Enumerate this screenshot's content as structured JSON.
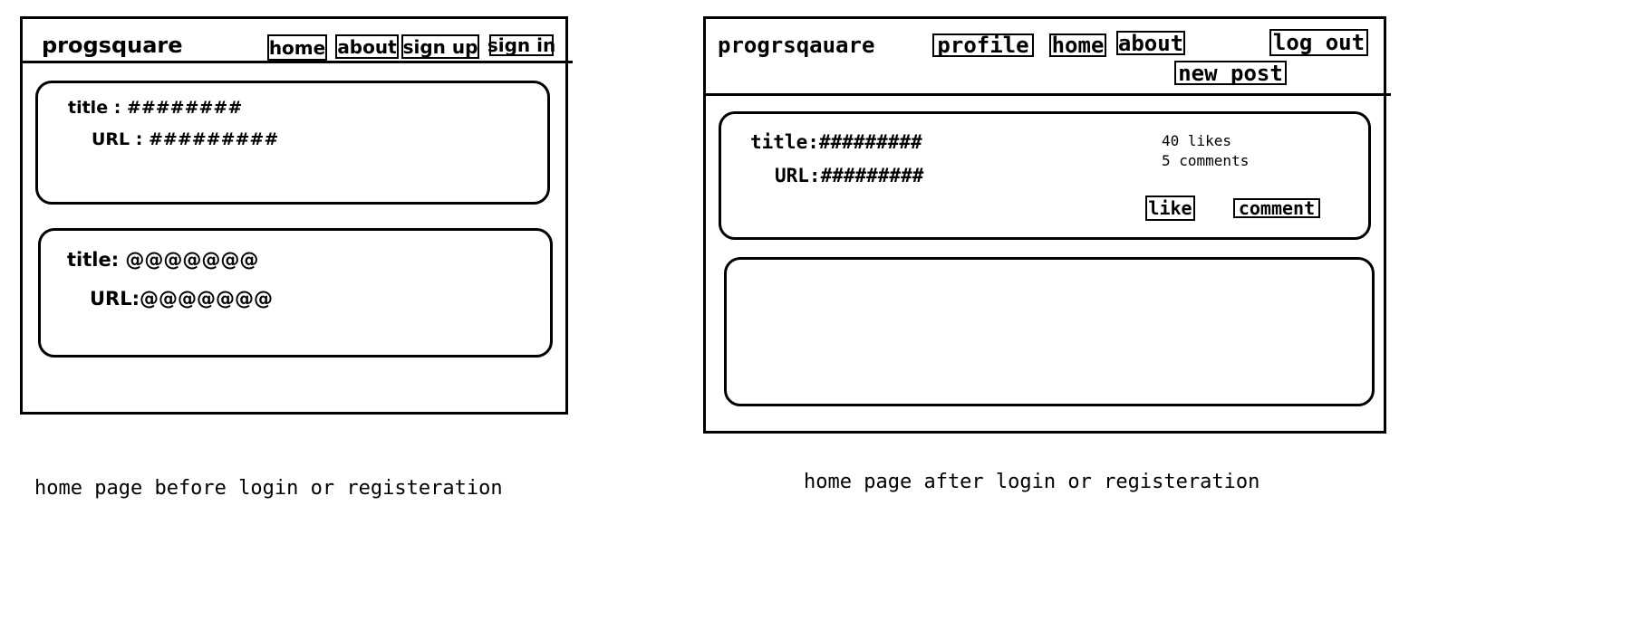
{
  "before": {
    "brand": "progsquare",
    "nav": {
      "home": "home",
      "about": "about",
      "sign_up": "sign up",
      "sign_in": "sign in"
    },
    "posts": [
      {
        "title": "title : ########",
        "url": "URL : #########"
      },
      {
        "title": "title: @@@@@@@",
        "url": "URL:@@@@@@@"
      }
    ],
    "caption": "home page before login or registeration"
  },
  "after": {
    "brand": "progrsqauare",
    "nav": {
      "profile": "profile",
      "home": "home",
      "about": "about",
      "log_out": "log out",
      "new_post": "new post"
    },
    "post": {
      "title": "title:#########",
      "url": "URL:#########",
      "likes": "40 likes",
      "comments": "5 comments",
      "like_button": "like",
      "comment_button": "comment"
    },
    "caption": "home page after login or registeration"
  }
}
